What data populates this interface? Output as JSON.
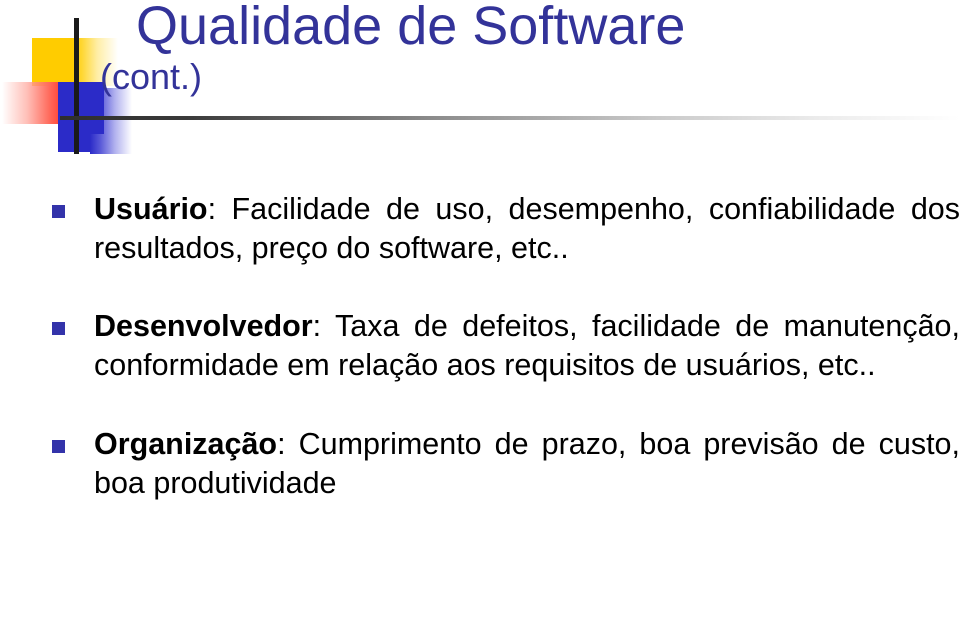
{
  "slide": {
    "title": "Qualidade de Software",
    "subtitle": "(cont.)",
    "colors": {
      "title_text": "#333399",
      "body_text": "#000000",
      "bullet_marker": "#3333AA",
      "logo_yellow": "#FFCC00",
      "logo_red": "#FF2B1E",
      "logo_blue": "#2B2BC8",
      "rule": "#2e2e2e",
      "background": "#FFFFFF"
    },
    "bullets": [
      {
        "lead": "Usuário",
        "separator": ": ",
        "text": "Facilidade de uso, desempenho, confiabilidade dos resultados, preço do software, etc.."
      },
      {
        "lead": "Desenvolvedor",
        "separator": ": ",
        "text": "Taxa de defeitos, facilidade de manutenção, conformidade em relação aos requisitos de usuários, etc.."
      },
      {
        "lead": "Organização",
        "separator": ": ",
        "text": "Cumprimento de prazo, boa previsão de custo, boa produtividade"
      }
    ]
  }
}
